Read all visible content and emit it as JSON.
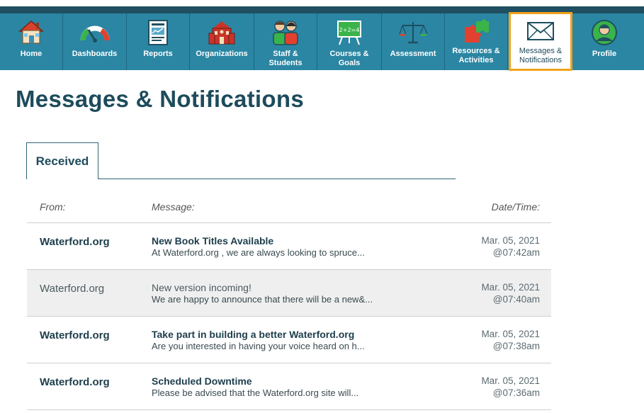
{
  "nav": {
    "items": [
      {
        "label": "Home",
        "icon": "house-icon"
      },
      {
        "label": "Dashboards",
        "icon": "gauge-icon"
      },
      {
        "label": "Reports",
        "icon": "report-icon"
      },
      {
        "label": "Organizations",
        "icon": "school-building-icon"
      },
      {
        "label": "Staff & Students",
        "icon": "people-icon"
      },
      {
        "label": "Courses & Goals",
        "icon": "chalkboard-icon"
      },
      {
        "label": "Assessment",
        "icon": "scales-icon"
      },
      {
        "label": "Resources &",
        "label2": "Activities",
        "icon": "puzzle-icon"
      },
      {
        "label": "Messages &",
        "label2": "Notifications",
        "icon": "envelope-icon",
        "active": true
      },
      {
        "label": "Profile",
        "icon": "user-avatar-icon"
      }
    ]
  },
  "page": {
    "title": "Messages & Notifications"
  },
  "tabs": [
    {
      "label": "Received",
      "active": true
    }
  ],
  "table": {
    "headers": {
      "from": "From:",
      "message": "Message:",
      "datetime": "Date/Time:"
    },
    "rows": [
      {
        "from": "Waterford.org",
        "subject": "New Book Titles Available",
        "preview": "At Waterford.org , we are always looking to spruce...",
        "date": "Mar. 05, 2021",
        "time": "@07:42am",
        "read": false
      },
      {
        "from": "Waterford.org",
        "subject": "New version incoming!",
        "preview": "We are happy to announce that there will be a new&...",
        "date": "Mar. 05, 2021",
        "time": "@07:40am",
        "read": true
      },
      {
        "from": "Waterford.org",
        "subject": "Take part in building a better Waterford.org",
        "preview": "Are you interested in having your voice heard on h...",
        "date": "Mar. 05, 2021",
        "time": "@07:38am",
        "read": false
      },
      {
        "from": "Waterford.org",
        "subject": "Scheduled Downtime",
        "preview": "Please be advised that the Waterford.org site will...",
        "date": "Mar. 05, 2021",
        "time": "@07:36am",
        "read": false
      }
    ]
  },
  "colors": {
    "nav_bg": "#2b86a3",
    "top_bar": "#1f4f60",
    "active_border": "#f2a21b",
    "title": "#1d4b5c"
  }
}
